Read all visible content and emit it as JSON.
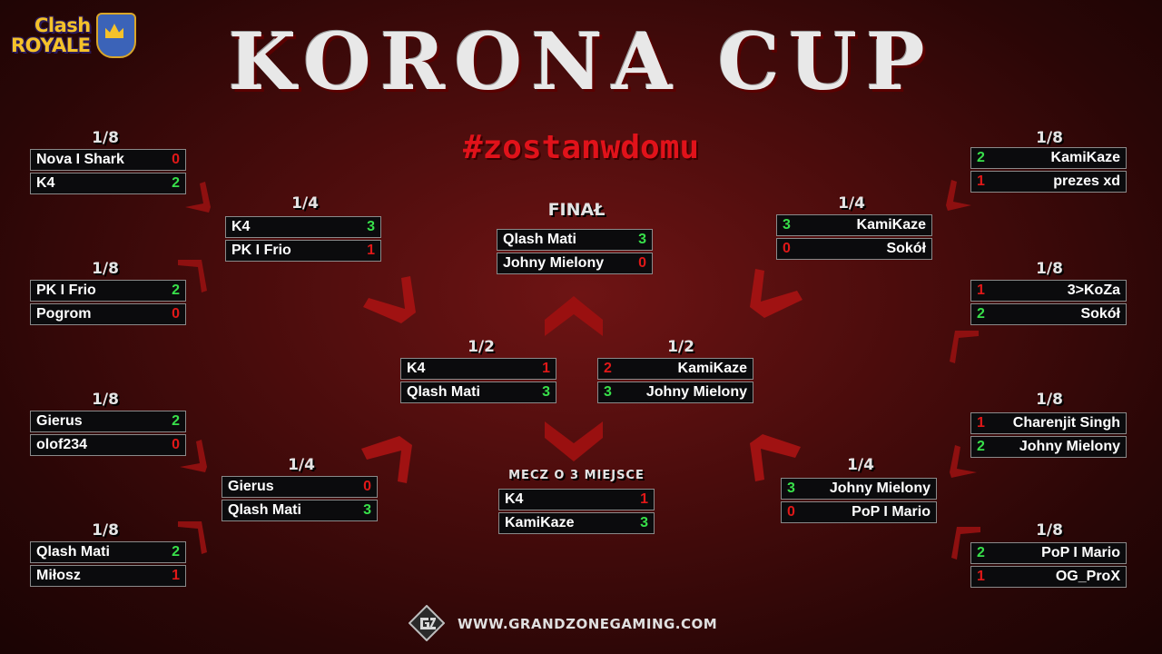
{
  "brand": {
    "logo_line1": "Clash",
    "logo_line2": "ROYALE"
  },
  "title": "KORONA CUP",
  "hashtag": "#zostanwdomu",
  "labels": {
    "r8": "1/8",
    "r4": "1/4",
    "r2": "1/2",
    "final": "FINAŁ",
    "third": "MECZ O 3 MIEJSCE"
  },
  "left": {
    "r8": [
      {
        "a": {
          "name": "Nova I Shark",
          "score": "0"
        },
        "b": {
          "name": "K4",
          "score": "2"
        }
      },
      {
        "a": {
          "name": "PK I Frio",
          "score": "2"
        },
        "b": {
          "name": "Pogrom",
          "score": "0"
        }
      },
      {
        "a": {
          "name": "Gierus",
          "score": "2"
        },
        "b": {
          "name": "olof234",
          "score": "0"
        }
      },
      {
        "a": {
          "name": "Qlash Mati",
          "score": "2"
        },
        "b": {
          "name": "Miłosz",
          "score": "1"
        }
      }
    ],
    "r4": [
      {
        "a": {
          "name": "K4",
          "score": "3"
        },
        "b": {
          "name": "PK I Frio",
          "score": "1"
        }
      },
      {
        "a": {
          "name": "Gierus",
          "score": "0"
        },
        "b": {
          "name": "Qlash Mati",
          "score": "3"
        }
      }
    ],
    "r2": {
      "a": {
        "name": "K4",
        "score": "1"
      },
      "b": {
        "name": "Qlash Mati",
        "score": "3"
      }
    }
  },
  "right": {
    "r8": [
      {
        "a": {
          "name": "KamiKaze",
          "score": "2"
        },
        "b": {
          "name": "prezes xd",
          "score": "1"
        }
      },
      {
        "a": {
          "name": "3>KoZa",
          "score": "1"
        },
        "b": {
          "name": "Sokół",
          "score": "2"
        }
      },
      {
        "a": {
          "name": "Charenjit Singh",
          "score": "1"
        },
        "b": {
          "name": "Johny Mielony",
          "score": "2"
        }
      },
      {
        "a": {
          "name": "PoP I Mario",
          "score": "2"
        },
        "b": {
          "name": "OG_ProX",
          "score": "1"
        }
      }
    ],
    "r4": [
      {
        "a": {
          "name": "KamiKaze",
          "score": "3"
        },
        "b": {
          "name": "Sokół",
          "score": "0"
        }
      },
      {
        "a": {
          "name": "Johny Mielony",
          "score": "3"
        },
        "b": {
          "name": "PoP I Mario",
          "score": "0"
        }
      }
    ],
    "r2": {
      "a": {
        "name": "KamiKaze",
        "score": "2"
      },
      "b": {
        "name": "Johny Mielony",
        "score": "3"
      }
    }
  },
  "final": {
    "a": {
      "name": "Qlash Mati",
      "score": "3"
    },
    "b": {
      "name": "Johny Mielony",
      "score": "0"
    }
  },
  "third": {
    "a": {
      "name": "K4",
      "score": "1"
    },
    "b": {
      "name": "KamiKaze",
      "score": "3"
    }
  },
  "footer": {
    "site": "WWW.GRANDZONEGAMING.COM"
  },
  "colors": {
    "win": "#38e04a",
    "lose": "#e01818",
    "accent": "#e0121a"
  }
}
